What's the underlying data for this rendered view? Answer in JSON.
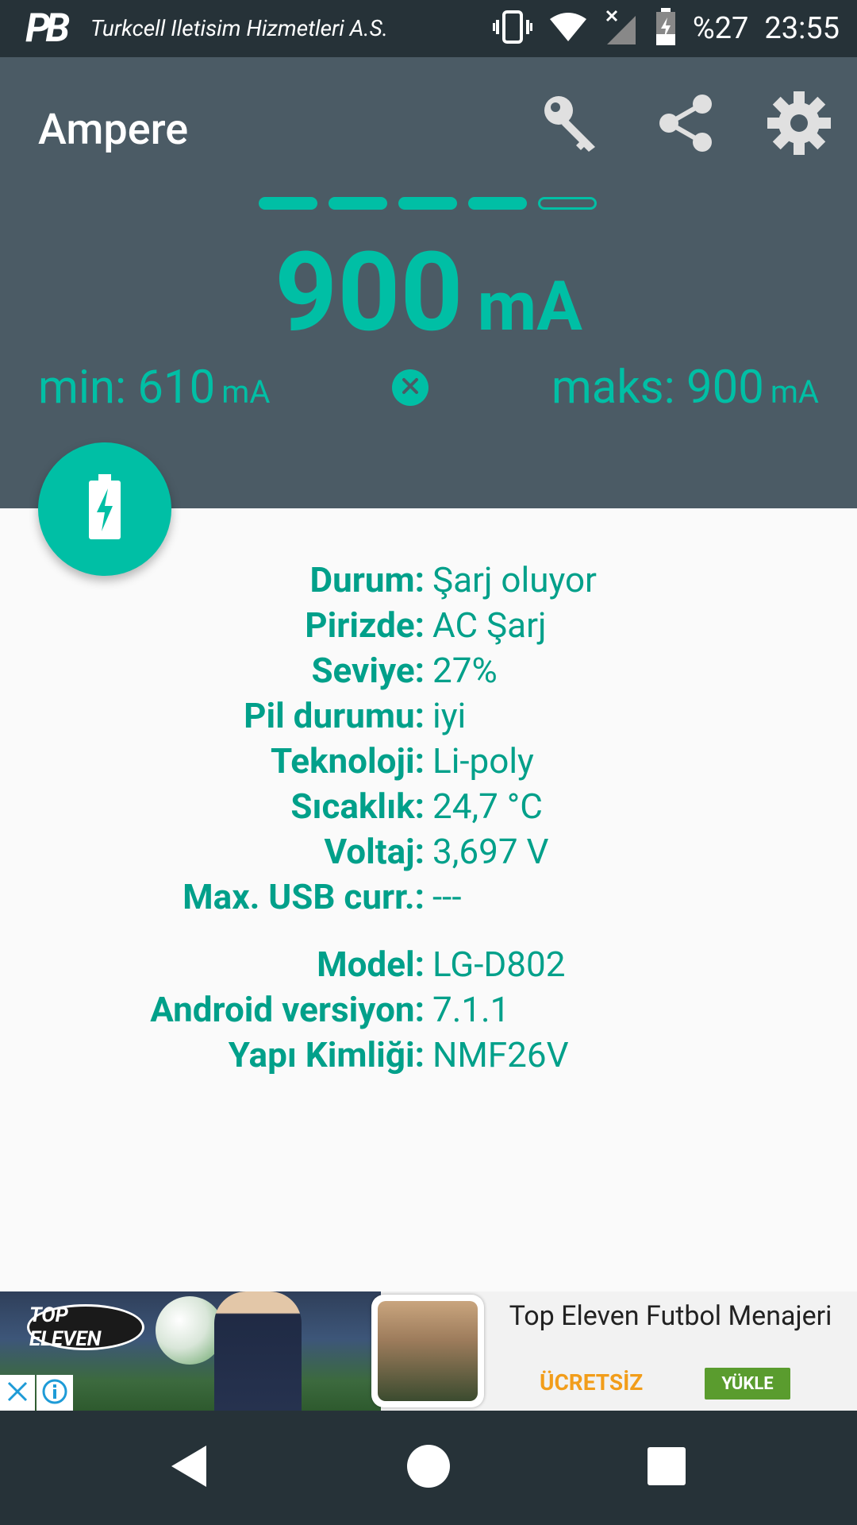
{
  "status_bar": {
    "logo": "PB",
    "carrier": "Turkcell Iletisim Hizmetleri A.S.",
    "battery_text": "%27",
    "time": "23:55",
    "icons": [
      "vibrate-icon",
      "wifi-icon",
      "no-signal-icon",
      "battery-charging-icon"
    ]
  },
  "app": {
    "title": "Ampere",
    "actions": [
      "key-icon",
      "share-icon",
      "settings-icon"
    ]
  },
  "meter": {
    "level_segments_filled": 4,
    "level_segments_total": 5,
    "current_value": "900",
    "current_unit": "mA",
    "min_label": "min: 610",
    "min_unit": "mA",
    "max_label": "maks: 900",
    "max_unit": "mA"
  },
  "info": [
    {
      "key": "Durum:",
      "value": "Şarj oluyor"
    },
    {
      "key": "Pirizde:",
      "value": "AC Şarj"
    },
    {
      "key": "Seviye:",
      "value": "27%"
    },
    {
      "key": "Pil durumu:",
      "value": "iyi"
    },
    {
      "key": "Teknoloji:",
      "value": "Li-poly"
    },
    {
      "key": "Sıcaklık:",
      "value": "24,7 °C"
    },
    {
      "key": "Voltaj:",
      "value": "3,697 V"
    },
    {
      "key": "Max. USB curr.:",
      "value": "---"
    }
  ],
  "device": [
    {
      "key": "Model:",
      "value": "LG-D802"
    },
    {
      "key": "Android versiyon:",
      "value": "7.1.1"
    },
    {
      "key": "Yapı Kimliği:",
      "value": "NMF26V"
    }
  ],
  "ad": {
    "logo_text": "TOP ELEVEN",
    "title": "Top Eleven Futbol Menajeri",
    "free_label": "ÜCRETSİZ",
    "install_label": "YÜKLE"
  },
  "colors": {
    "accent": "#00bfa5",
    "header": "#4b5b65",
    "statusbar": "#263238",
    "text": "#00a08a"
  }
}
